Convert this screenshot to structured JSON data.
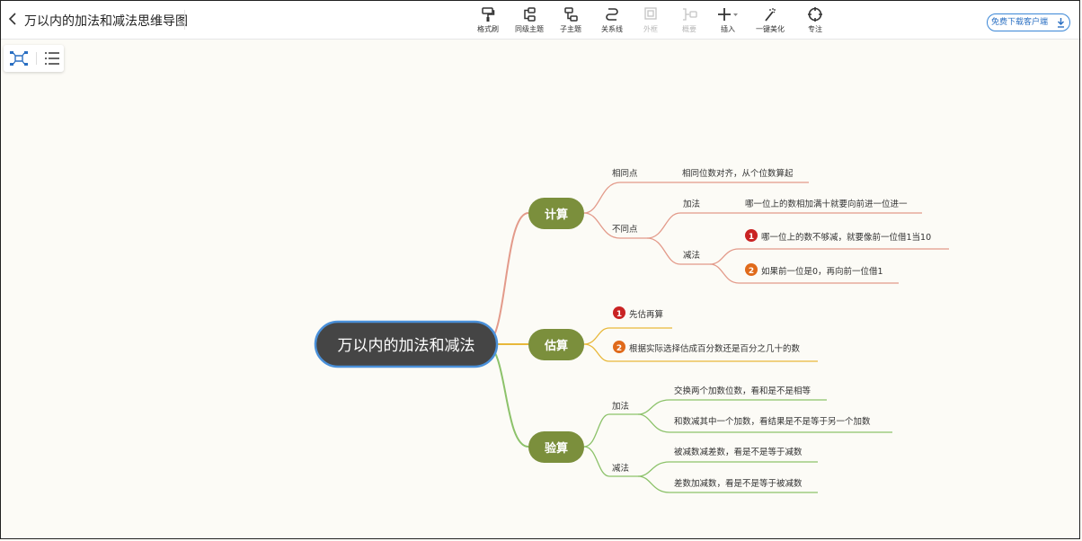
{
  "header": {
    "back_icon": "chevron-left-icon",
    "title": "万以内的加法和减法思维导图"
  },
  "toolbar": [
    {
      "key": "format",
      "label": "格式刷",
      "icon": "format-painter-icon",
      "enabled": true
    },
    {
      "key": "sibling",
      "label": "同级主题",
      "icon": "sibling-topic-icon",
      "enabled": true
    },
    {
      "key": "child",
      "label": "子主题",
      "icon": "child-topic-icon",
      "enabled": true
    },
    {
      "key": "relation",
      "label": "关系线",
      "icon": "relation-line-icon",
      "enabled": true
    },
    {
      "key": "boundary",
      "label": "外框",
      "icon": "boundary-icon",
      "enabled": false
    },
    {
      "key": "summary",
      "label": "概要",
      "icon": "summary-icon",
      "enabled": false
    },
    {
      "key": "insert",
      "label": "插入",
      "icon": "plus-icon",
      "enabled": true
    },
    {
      "key": "beautify",
      "label": "一键美化",
      "icon": "magic-wand-icon",
      "enabled": true
    },
    {
      "key": "focus",
      "label": "专注",
      "icon": "crosshair-icon",
      "enabled": true
    }
  ],
  "download_label": "免费下载客户端",
  "view_switch": {
    "mindmap_icon": "mindmap-view-icon",
    "outline_icon": "outline-view-icon"
  },
  "colors": {
    "root": "#454545",
    "root_border": "#4a90d9",
    "red_branch": "#7b8f3c",
    "red_line": "#e39a8a",
    "yellow_line": "#e8b83a",
    "green_line": "#8cc26a",
    "badge1": "#c92323",
    "badge2": "#e06a1b"
  },
  "mindmap": {
    "root": "万以内的加法和减法",
    "branches": [
      {
        "label": "计算",
        "children": [
          {
            "label": "相同点",
            "children": [
              {
                "label": "相同位数对齐，从个位数算起"
              }
            ]
          },
          {
            "label": "不同点",
            "children": [
              {
                "label": "加法",
                "children": [
                  {
                    "label": "哪一位上的数相加满十就要向前进一位进一"
                  }
                ]
              },
              {
                "label": "减法",
                "children": [
                  {
                    "label": "哪一位上的数不够减，就要像前一位借1当10",
                    "badge": "1"
                  },
                  {
                    "label": "如果前一位是0，再向前一位借1",
                    "badge": "2"
                  }
                ]
              }
            ]
          }
        ]
      },
      {
        "label": "估算",
        "children": [
          {
            "label": "先估再算",
            "badge": "1"
          },
          {
            "label": "根据实际选择估成百分数还是百分之几十的数",
            "badge": "2"
          }
        ]
      },
      {
        "label": "验算",
        "children": [
          {
            "label": "加法",
            "children": [
              {
                "label": "交换两个加数位数，看和是不是相等"
              },
              {
                "label": "和数减其中一个加数，看结果是不是等于另一个加数"
              }
            ]
          },
          {
            "label": "减法",
            "children": [
              {
                "label": "被减数减差数，看是不是等于减数"
              },
              {
                "label": "差数加减数，看是不是等于被减数"
              }
            ]
          }
        ]
      }
    ]
  }
}
